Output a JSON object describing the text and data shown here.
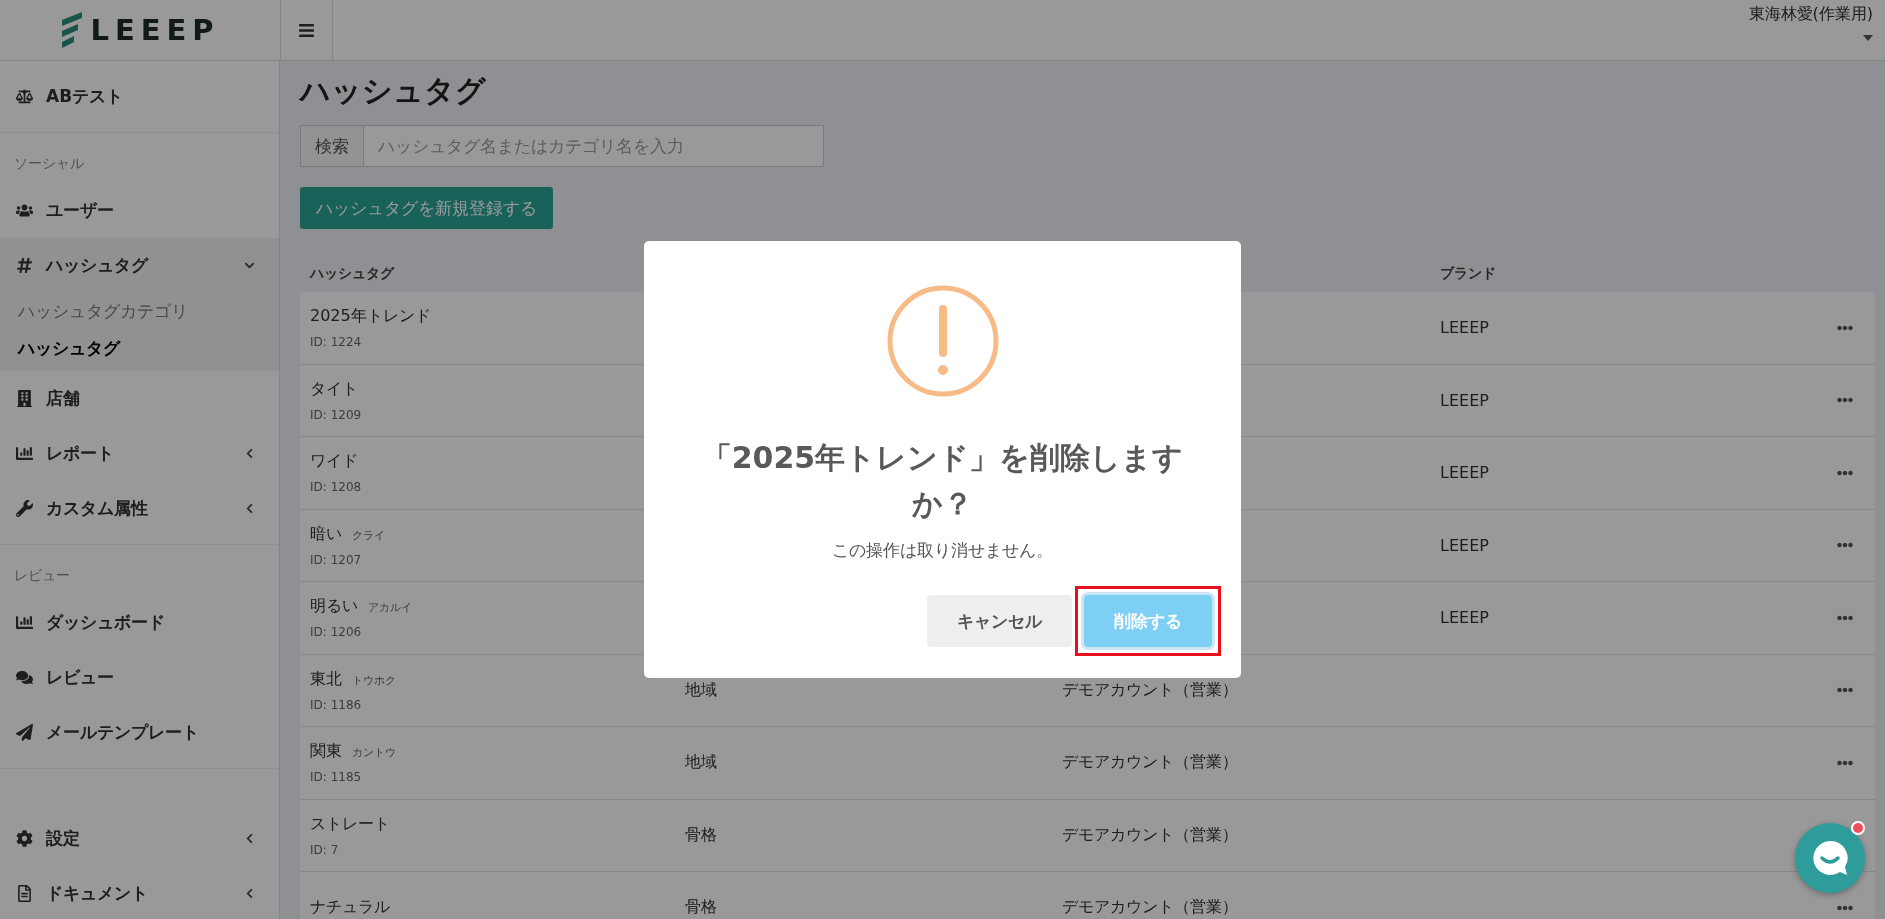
{
  "header": {
    "logo": "LEEEP",
    "user": "東海林愛(作業用)"
  },
  "sidebar": {
    "sections": [
      {
        "items": [
          {
            "label": "ABテスト"
          }
        ]
      },
      {
        "title": "ソーシャル",
        "items": [
          {
            "label": "ユーザー"
          },
          {
            "label": "ハッシュタグ",
            "expanded": true,
            "children": [
              {
                "label": "ハッシュタグカテゴリ",
                "selected": false
              },
              {
                "label": "ハッシュタグ",
                "selected": true
              }
            ]
          },
          {
            "label": "店舗"
          },
          {
            "label": "レポート",
            "expanded": false
          },
          {
            "label": "カスタム属性",
            "expanded": false
          }
        ]
      },
      {
        "title": "レビュー",
        "items": [
          {
            "label": "ダッシュボード"
          },
          {
            "label": "レビュー"
          },
          {
            "label": "メールテンプレート"
          }
        ]
      },
      {
        "items": [
          {
            "label": "設定",
            "expanded": false
          },
          {
            "label": "ドキュメント",
            "expanded": false
          }
        ]
      }
    ]
  },
  "page": {
    "title": "ハッシュタグ",
    "search": {
      "label": "検索",
      "placeholder": "ハッシュタグ名またはカテゴリ名を入力"
    },
    "add_button": "ハッシュタグを新規登録する",
    "table": {
      "columns": {
        "hashtag": "ハッシュタグ",
        "brand": "ブランド"
      },
      "rows": [
        {
          "name": "2025年トレンド",
          "id": "ID: 1224",
          "brand": "LEEEP",
          "actions_menu": true
        },
        {
          "name": "タイト",
          "id": "ID: 1209",
          "brand": "LEEEP",
          "actions_menu": true
        },
        {
          "name": "ワイド",
          "id": "ID: 1208",
          "brand": "LEEEP",
          "actions_menu": true
        },
        {
          "name": "暗い",
          "reading": "クライ",
          "id": "ID: 1207",
          "brand": "LEEEP",
          "actions_menu": true
        },
        {
          "name": "明るい",
          "reading": "アカルイ",
          "id": "ID: 1206",
          "brand": "LEEEP",
          "actions_menu": true
        },
        {
          "name": "東北",
          "reading": "トウホク",
          "id": "ID: 1186",
          "category": "地域",
          "account": "デモアカウント（営業）",
          "actions_menu": true
        },
        {
          "name": "関東",
          "reading": "カントウ",
          "id": "ID: 1185",
          "category": "地域",
          "account": "デモアカウント（営業）",
          "actions_menu": true
        },
        {
          "name": "ストレート",
          "id": "ID: 7",
          "category": "骨格",
          "account": "デモアカウント（営業）",
          "actions_menu": false
        },
        {
          "name": "ナチュラル",
          "category": "骨格",
          "account": "デモアカウント（営業）",
          "actions_menu": true
        }
      ]
    }
  },
  "modal": {
    "title": "「2025年トレンド」を削除しますか？",
    "message": "この操作は取り消せません。",
    "buttons": [
      {
        "label": "キャンセル",
        "kind": "cancel",
        "highlighted": false
      },
      {
        "label": "削除する",
        "kind": "confirm",
        "highlighted": true
      }
    ]
  },
  "chat": {
    "unread": true
  }
}
